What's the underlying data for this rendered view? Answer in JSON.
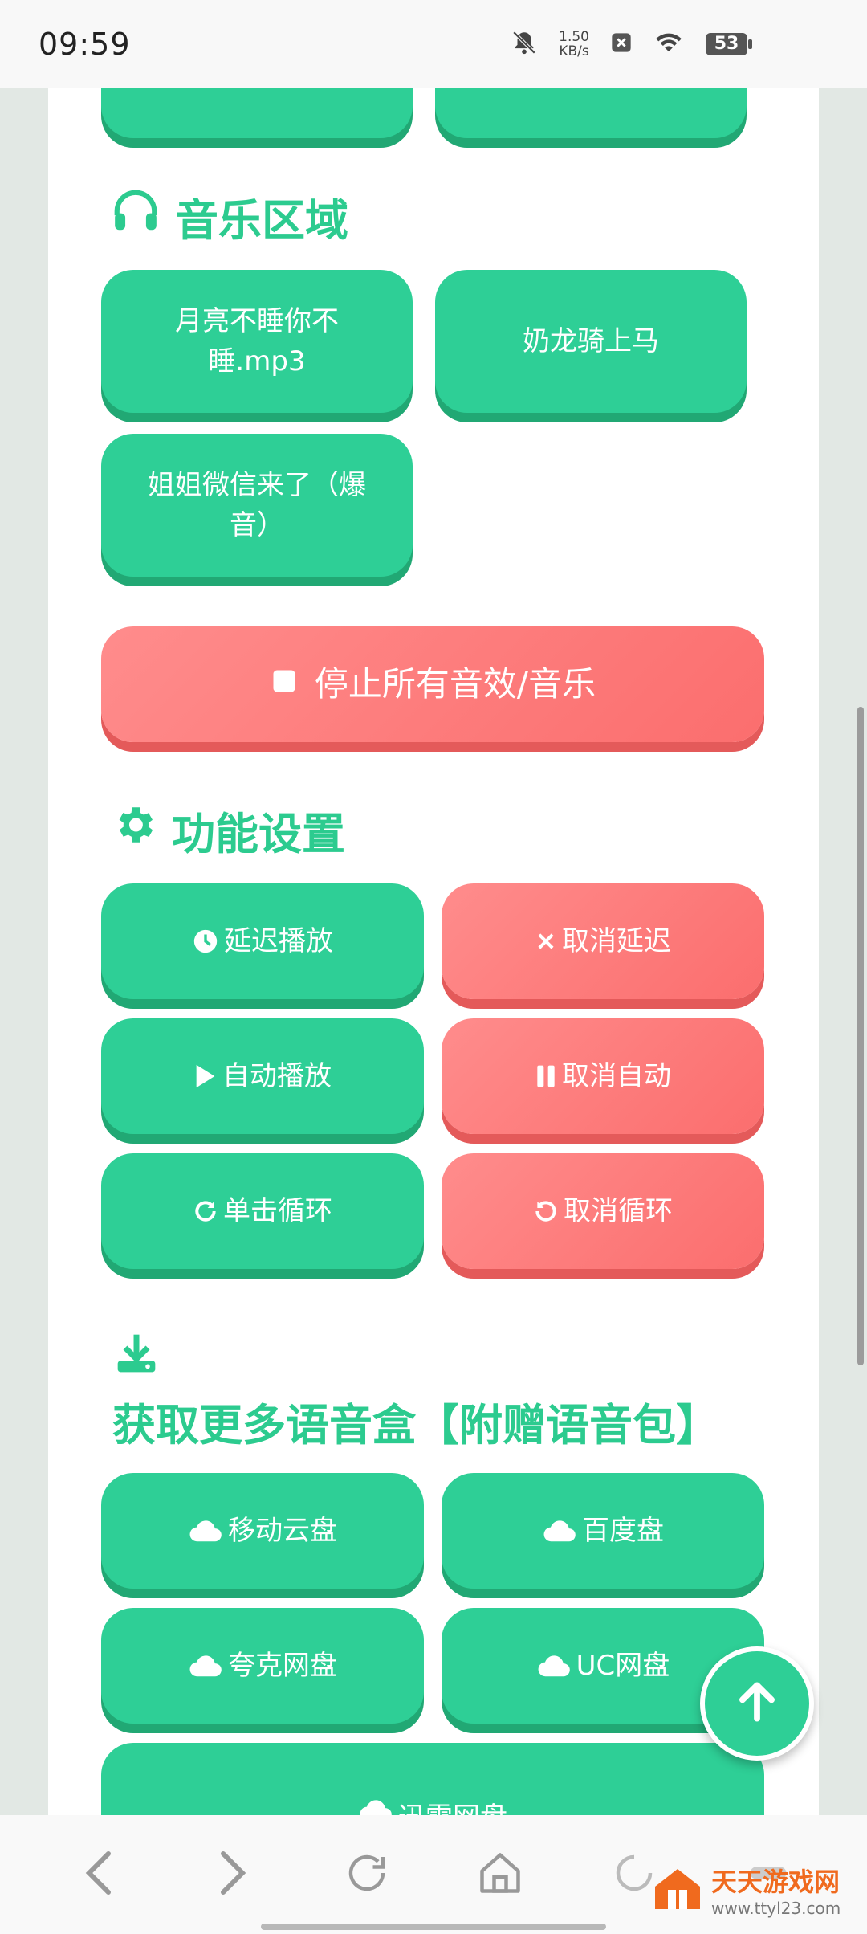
{
  "status_bar": {
    "time": "09:59",
    "net_speed": "1.50",
    "net_unit": "KB/s",
    "battery": "53"
  },
  "sections": {
    "music_title": "音乐区域",
    "function_title": "功能设置",
    "more_title": "获取更多语音盒【附赠语音包】"
  },
  "music": [
    {
      "label": "月亮不睡你不睡.mp3"
    },
    {
      "label": "奶龙骑上马"
    },
    {
      "label": "姐姐微信来了（爆音）"
    }
  ],
  "stop_all": "停止所有音效/音乐",
  "functions": {
    "delay": "延迟播放",
    "cancel_delay": "取消延迟",
    "autoplay": "自动播放",
    "cancel_auto": "取消自动",
    "loop": "单击循环",
    "cancel_loop": "取消循环"
  },
  "downloads": {
    "mobile": "移动云盘",
    "baidu": "百度盘",
    "quark": "夸克网盘",
    "uc": "UC网盘",
    "xunlei": "迅雷网盘"
  },
  "watermark": {
    "name": "天天游戏网",
    "url": "www.ttyl23.com"
  },
  "colors": {
    "green": "#2ecf96",
    "red": "#fb6e6e",
    "title_green": "#2ccb8f"
  }
}
